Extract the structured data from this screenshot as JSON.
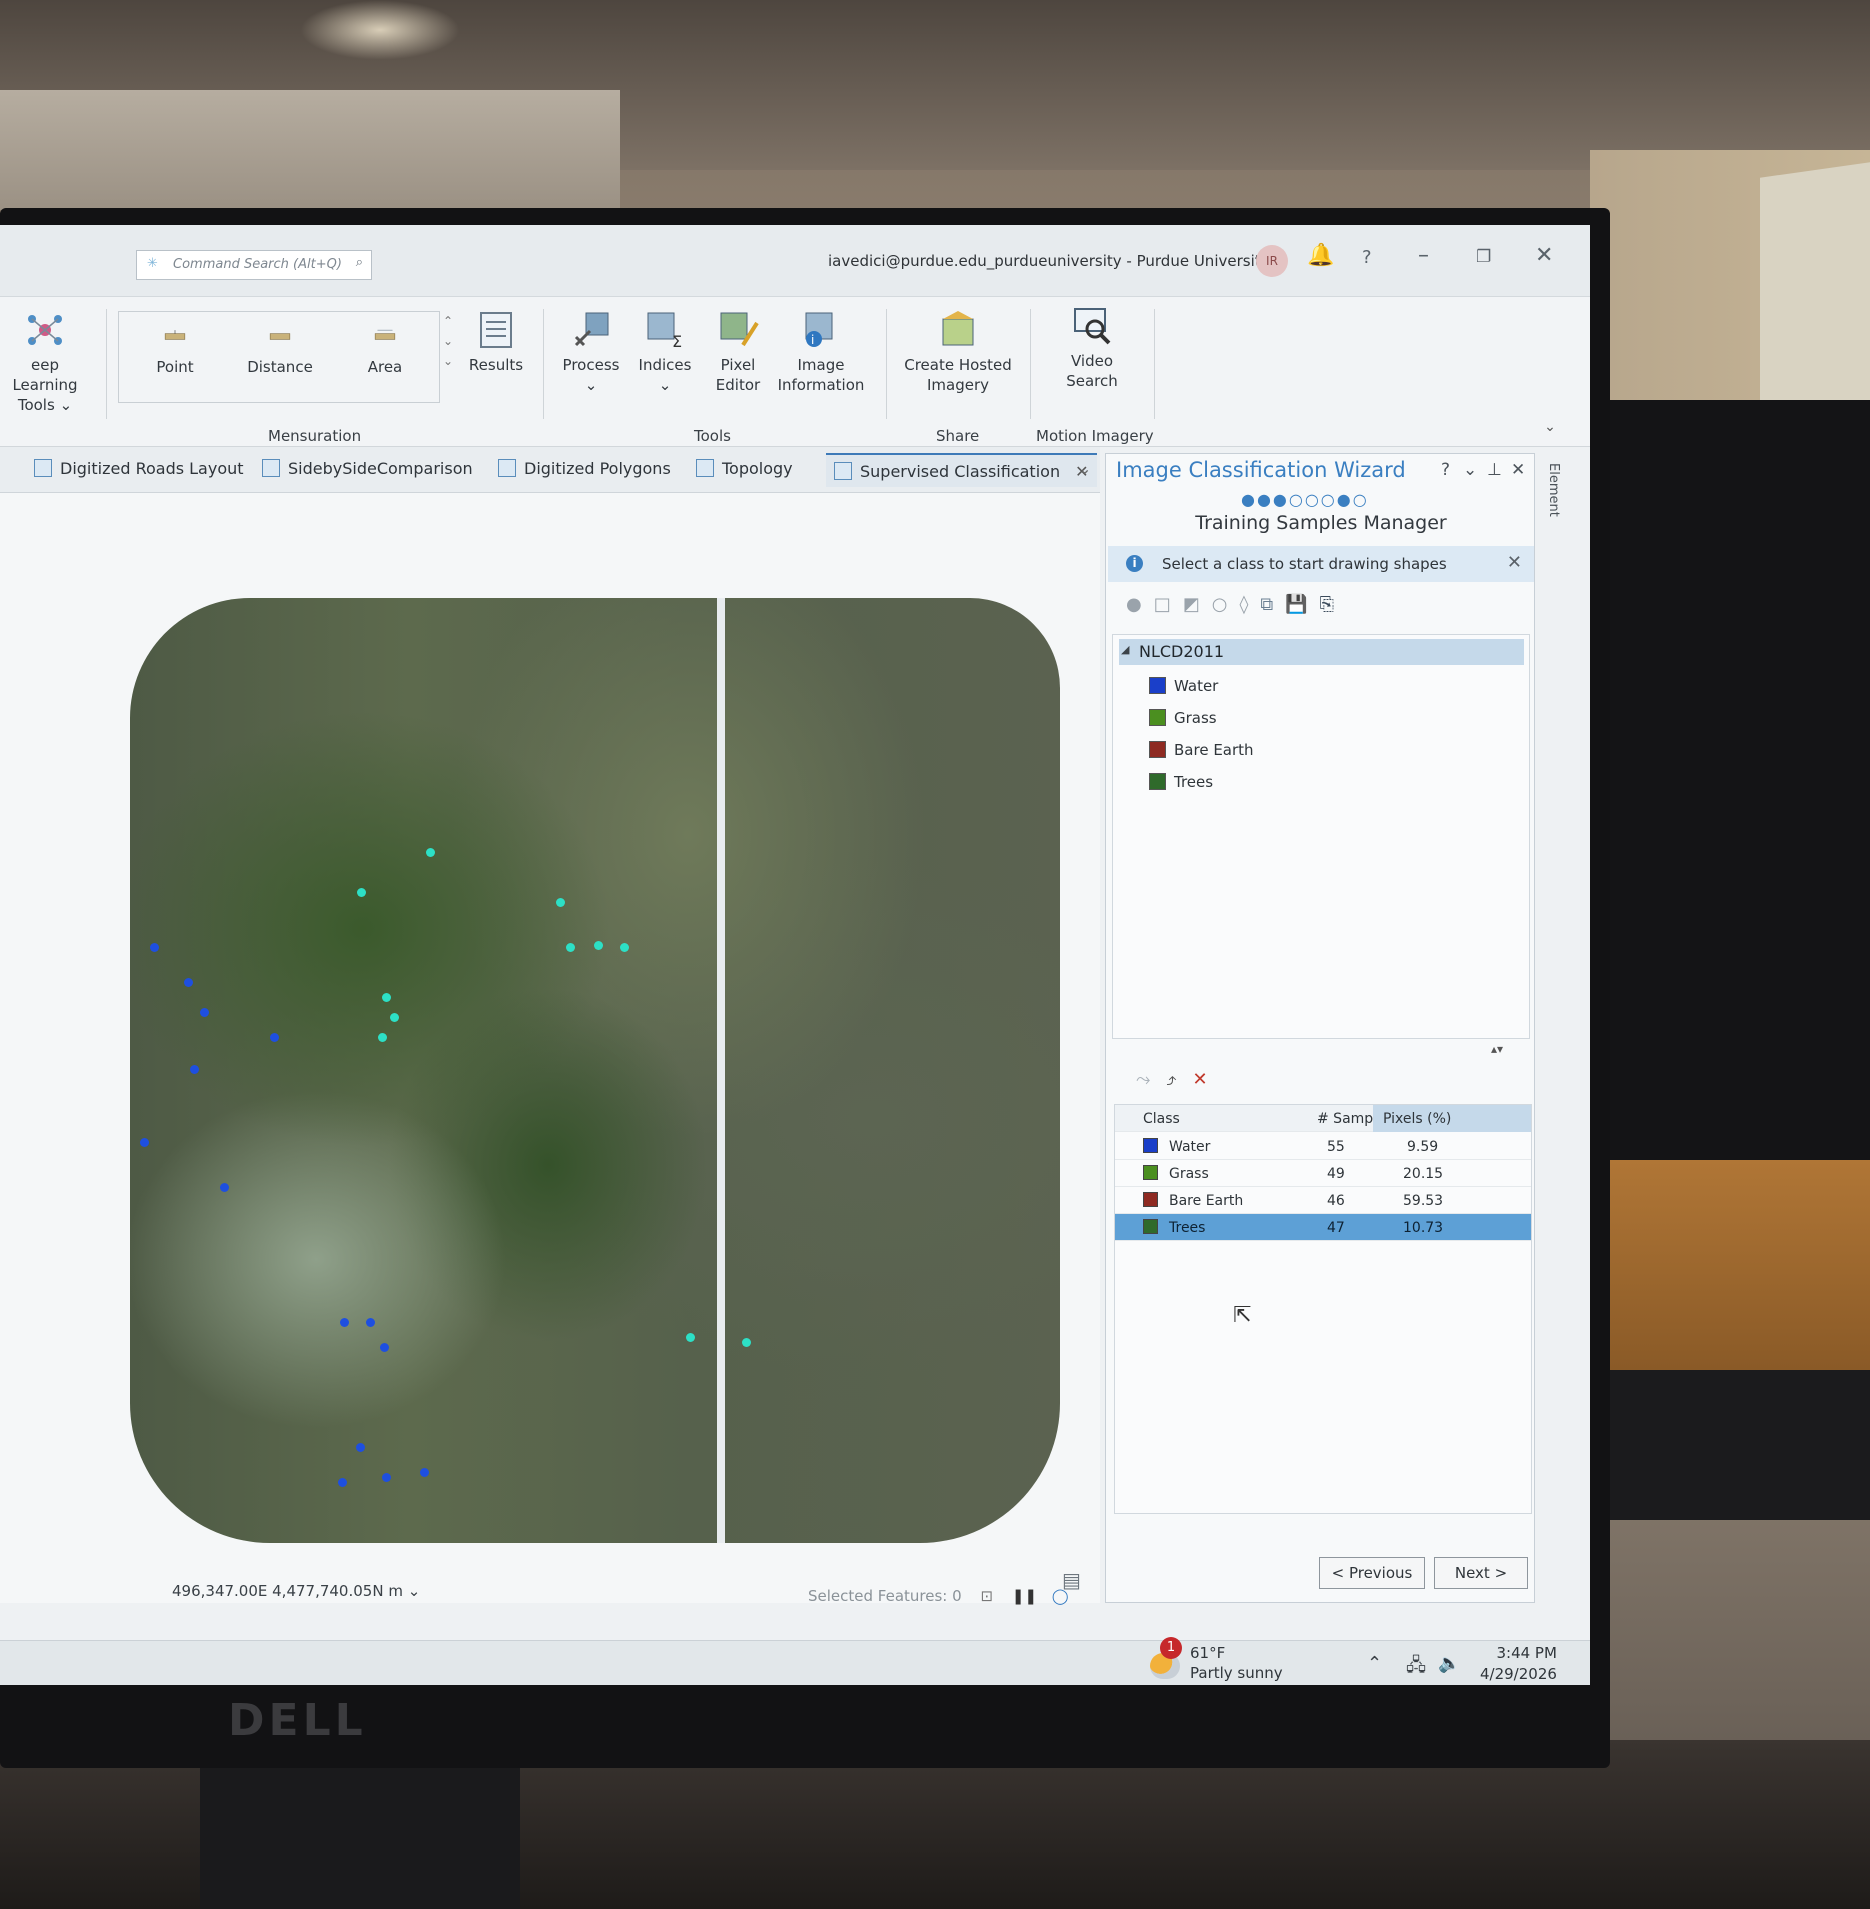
{
  "titlebar": {
    "search_placeholder": "Command Search (Alt+Q)",
    "user": "iavedici@purdue.edu_purdueuniversity - Purdue University",
    "avatar": "IR",
    "icons": [
      "bell-icon",
      "help-icon",
      "minimize-icon",
      "restore-icon",
      "close-icon"
    ]
  },
  "ribbon": {
    "deep_learning": "eep Learning",
    "deep_learning_sub": "Tools",
    "point": "Point",
    "distance": "Distance",
    "area": "Area",
    "results": "Results",
    "process": "Process",
    "indices": "Indices",
    "pixel_editor_1": "Pixel",
    "pixel_editor_2": "Editor",
    "image_info_1": "Image",
    "image_info_2": "Information",
    "hosted_1": "Create Hosted",
    "hosted_2": "Imagery",
    "video_1": "Video",
    "video_2": "Search",
    "groups": {
      "mensuration": "Mensuration",
      "tools": "Tools",
      "share": "Share",
      "motion": "Motion Imagery"
    }
  },
  "tabs": [
    {
      "label": "Digitized Roads Layout"
    },
    {
      "label": "SidebySideComparison"
    },
    {
      "label": "Digitized Polygons"
    },
    {
      "label": "Topology"
    },
    {
      "label": "Supervised Classification"
    }
  ],
  "map": {
    "coords": "496,347.00E 4,477,740.05N m",
    "selected": "Selected Features: 0"
  },
  "wizard": {
    "title": "Image Classification Wizard",
    "subtitle": "Training Samples Manager",
    "info": "Select a class to start drawing shapes",
    "step": 3,
    "steps_total": 7,
    "schema": "NLCD2011",
    "classes": [
      {
        "name": "Water",
        "color": "#1a3fc9"
      },
      {
        "name": "Grass",
        "color": "#4b8f20"
      },
      {
        "name": "Bare Earth",
        "color": "#8e2a22"
      },
      {
        "name": "Trees",
        "color": "#2f6a2b"
      }
    ],
    "table": {
      "headers": [
        "Class",
        "# Samples",
        "Pixels (%)"
      ],
      "rows": [
        {
          "class": "Water",
          "samples": "55",
          "pixels": "9.59"
        },
        {
          "class": "Grass",
          "samples": "49",
          "pixels": "20.15"
        },
        {
          "class": "Bare Earth",
          "samples": "46",
          "pixels": "59.53"
        },
        {
          "class": "Trees",
          "samples": "47",
          "pixels": "10.73"
        }
      ]
    },
    "previous": "< Previous",
    "next": "Next >",
    "side_tab": "Element"
  },
  "taskbar": {
    "temp": "61°F",
    "weather": "Partly sunny",
    "badge": "1",
    "time": "3:44 PM",
    "date": "4/29/2026"
  },
  "monitor_brand": "DELL"
}
